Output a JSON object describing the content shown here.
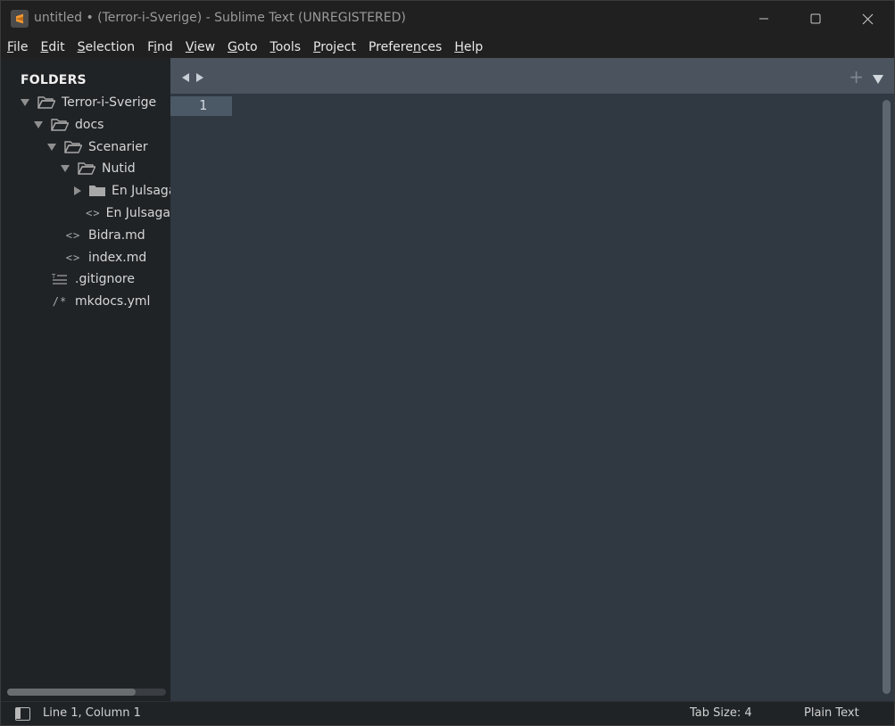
{
  "window": {
    "title": "untitled • (Terror-i-Sverige) - Sublime Text (UNREGISTERED)"
  },
  "menu": [
    {
      "pre": "",
      "ul": "F",
      "post": "ile"
    },
    {
      "pre": "",
      "ul": "E",
      "post": "dit"
    },
    {
      "pre": "",
      "ul": "S",
      "post": "election"
    },
    {
      "pre": "F",
      "ul": "i",
      "post": "nd"
    },
    {
      "pre": "",
      "ul": "V",
      "post": "iew"
    },
    {
      "pre": "",
      "ul": "G",
      "post": "oto"
    },
    {
      "pre": "",
      "ul": "T",
      "post": "ools"
    },
    {
      "pre": "",
      "ul": "P",
      "post": "roject"
    },
    {
      "pre": "Prefere",
      "ul": "n",
      "post": "ces"
    },
    {
      "pre": "",
      "ul": "H",
      "post": "elp"
    }
  ],
  "sidebar": {
    "header": "FOLDERS",
    "tree": [
      {
        "label": "Terror-i-Sverige",
        "kind": "folder-open",
        "arrow": "down",
        "depth": 0
      },
      {
        "label": "docs",
        "kind": "folder-open",
        "arrow": "down",
        "depth": 1
      },
      {
        "label": "Scenarier",
        "kind": "folder-open",
        "arrow": "down",
        "depth": 2
      },
      {
        "label": "Nutid",
        "kind": "folder-open",
        "arrow": "down",
        "depth": 3
      },
      {
        "label": "En Julsaga",
        "kind": "folder",
        "arrow": "right",
        "depth": 4
      },
      {
        "label": "En Julsaga",
        "kind": "code",
        "arrow": "",
        "depth": 4
      },
      {
        "label": "Bidra.md",
        "kind": "code",
        "arrow": "",
        "depth": 2
      },
      {
        "label": "index.md",
        "kind": "code",
        "arrow": "",
        "depth": 2
      },
      {
        "label": ".gitignore",
        "kind": "text",
        "arrow": "",
        "depth": 1
      },
      {
        "label": "mkdocs.yml",
        "kind": "comment",
        "arrow": "",
        "depth": 1
      }
    ]
  },
  "tabbar": {
    "plus": "+"
  },
  "editor": {
    "line_number": "1"
  },
  "status": {
    "position": "Line 1, Column 1",
    "tab_size": "Tab Size: 4",
    "syntax": "Plain Text"
  },
  "colors": {
    "titlebar": "#202020",
    "sidebar": "#202326",
    "tabbar": "#4b545e",
    "editor": "#303841",
    "gutter_highlight": "#4b5966",
    "accent": "#f79a32"
  }
}
